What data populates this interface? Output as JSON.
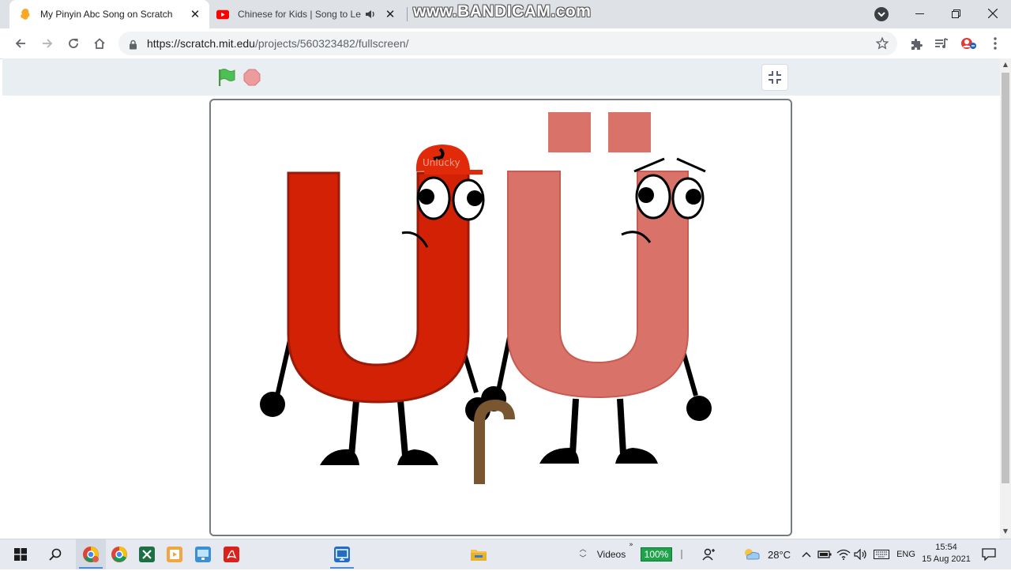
{
  "browser": {
    "tabs": [
      {
        "title": "My Pinyin Abc Song on Scratch",
        "active": true
      },
      {
        "title": "Chinese for Kids | Song to Le",
        "active": false
      }
    ],
    "watermark": "www.BANDICAM.com",
    "url_host": "https://scratch.mit.edu",
    "url_path": "/projects/560323482/fullscreen/"
  },
  "stage": {
    "cap_text": "Unlucky",
    "colors": {
      "u_left": "#d32106",
      "u_right": "#d9736a",
      "cane": "#7a5630"
    }
  },
  "taskbar": {
    "widget_label": "Videos",
    "widget_value": "100%",
    "temperature": "28°C",
    "language": "ENG",
    "time": "15:54",
    "date": "15 Aug 2021"
  }
}
